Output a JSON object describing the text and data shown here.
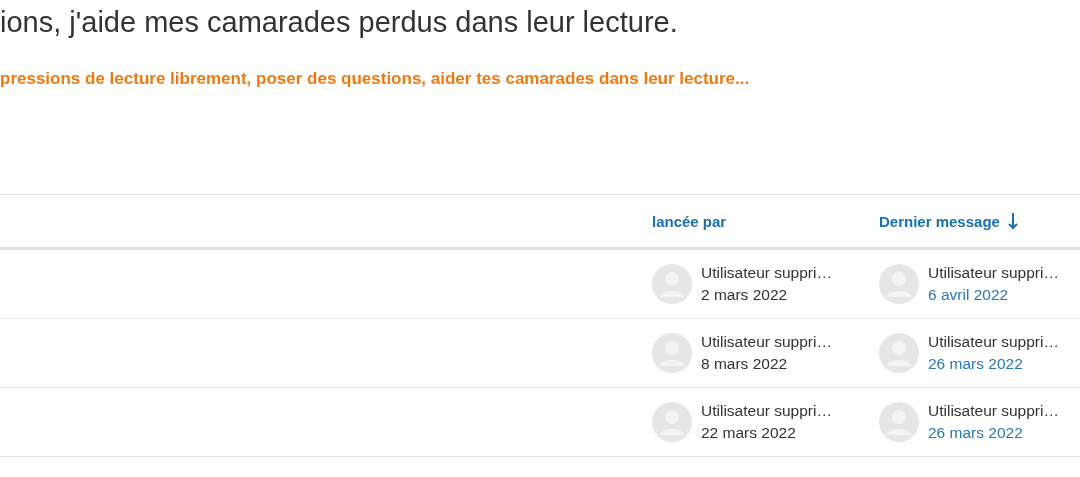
{
  "heading": "ions, j'aide mes camarades perdus dans leur lecture.",
  "subtitle": "pressions de lecture librement, poser des questions, aider tes camarades dans leur lecture...",
  "table": {
    "columns": [
      {
        "label": "lancée par",
        "sorted": false
      },
      {
        "label": "Dernier message",
        "sorted": true
      }
    ],
    "rows": [
      {
        "started_by": {
          "name": "Utilisateur suppri…",
          "date": "2 mars 2022"
        },
        "last_post": {
          "name": "Utilisateur suppri…",
          "date": "6 avril 2022"
        }
      },
      {
        "started_by": {
          "name": "Utilisateur suppri…",
          "date": "8 mars 2022"
        },
        "last_post": {
          "name": "Utilisateur suppri…",
          "date": "26 mars 2022"
        }
      },
      {
        "started_by": {
          "name": "Utilisateur suppri…",
          "date": "22 mars 2022"
        },
        "last_post": {
          "name": "Utilisateur suppri…",
          "date": "26 mars 2022"
        }
      }
    ]
  }
}
